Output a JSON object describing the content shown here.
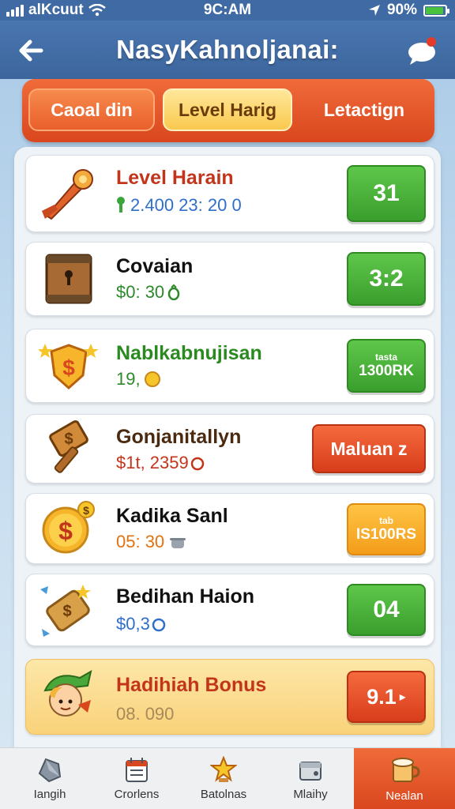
{
  "status_bar": {
    "carrier": "alKcuut",
    "time": "9C:AM",
    "battery": "90%",
    "battery_level": 0.9
  },
  "header": {
    "title": "NasyKahnoljanai:",
    "back_icon": "arrow-left-icon",
    "chat_icon": "chat-bubble-icon"
  },
  "tabs": [
    {
      "label": "Caoal din",
      "state": "normal"
    },
    {
      "label": "Level Harig",
      "state": "selected"
    },
    {
      "label": "Letactign",
      "state": "normal"
    }
  ],
  "items": [
    {
      "name": "Level Harain",
      "sub": "2.400 23: 20 0",
      "sub_prefix_icon": "key-icon",
      "name_color": "#c2351b",
      "sub_color": "#2f6fc9",
      "button_text": "31",
      "button_color": "green",
      "icon": "torch-icon"
    },
    {
      "name": "Covaian",
      "sub": "$0: 30",
      "sub_suffix_icon": "bag-icon",
      "name_color": "#111111",
      "sub_color": "#2c8a2a",
      "button_text": "3:2",
      "button_color": "green",
      "icon": "treasure-chest-icon"
    },
    {
      "name": "Nablkabnujisan",
      "sub": "19,",
      "sub_suffix_icon": "coin-icon",
      "name_color": "#2a8a20",
      "sub_color": "#2c8a2a",
      "button_top": "tasta",
      "button_text": "1300RK",
      "button_color": "green",
      "icon": "star-shield-icon"
    },
    {
      "name": "Gonjanitallyn",
      "sub": "$1t, 2359",
      "sub_suffix_icon": "coin-icon",
      "name_color": "#4a2a10",
      "sub_color": "#c2351b",
      "button_text": "Maluan z",
      "button_color": "red",
      "icon": "hammer-icon"
    },
    {
      "name": "Kadika Sanl",
      "sub": "05: 30",
      "sub_suffix_icon": "pot-icon",
      "name_color": "#111111",
      "sub_color": "#e3720f",
      "button_top": "tab",
      "button_text": "IS100RS",
      "button_color": "orange",
      "icon": "dollar-coin-icon"
    },
    {
      "name": "Bedihan Haion",
      "sub": "$0,3",
      "sub_suffix_icon": "coin-icon",
      "name_color": "#111111",
      "sub_color": "#2f6fc9",
      "button_text": "04",
      "button_color": "green",
      "icon": "money-tag-icon"
    },
    {
      "name": "Hadihiah Bonus",
      "sub": "08. 090",
      "name_color": "#c2351b",
      "sub_color": "#a88a5a",
      "button_text": "9.1",
      "button_suffix": "▸",
      "button_color": "red",
      "icon": "elf-character-icon",
      "highlight": true
    }
  ],
  "bottom_nav": [
    {
      "label": "Iangih",
      "icon": "crystal-icon"
    },
    {
      "label": "Crorlens",
      "icon": "calendar-icon"
    },
    {
      "label": "Batolnas",
      "icon": "star-trophy-icon"
    },
    {
      "label": "Mlaihy",
      "icon": "box-icon"
    },
    {
      "label": "Nealan",
      "icon": "mug-icon",
      "active": true
    }
  ]
}
